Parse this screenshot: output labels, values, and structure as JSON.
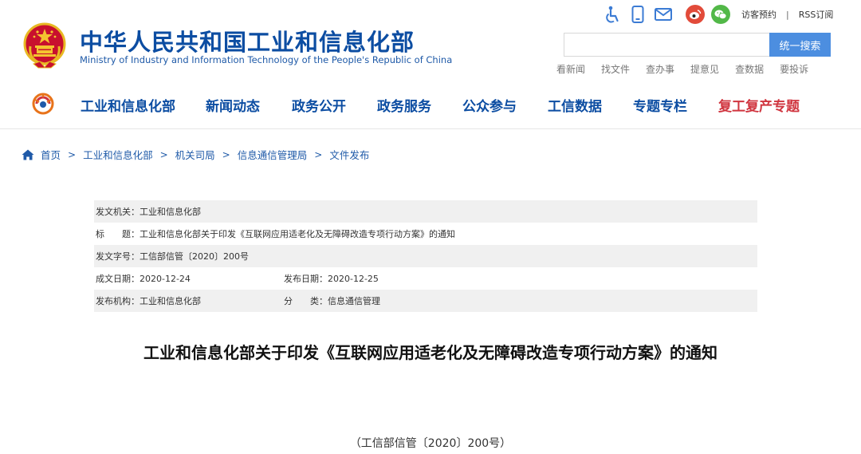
{
  "header": {
    "title": "中华人民共和国工业和信息化部",
    "subtitle": "Ministry of Industry and Information Technology of the People's Republic of China",
    "top_links": {
      "visit": "访客预约",
      "separator": "|",
      "rss": "RSS订阅"
    },
    "icons": [
      "accessibility-icon",
      "mobile-icon",
      "mail-icon",
      "weibo-icon",
      "wechat-icon"
    ],
    "search": {
      "placeholder": "",
      "button": "统一搜索"
    },
    "quick_links": [
      "看新闻",
      "找文件",
      "查办事",
      "提意见",
      "查数据",
      "要投诉"
    ]
  },
  "nav": {
    "items": [
      "工业和信息化部",
      "新闻动态",
      "政务公开",
      "政务服务",
      "公众参与",
      "工信数据",
      "专题专栏",
      "复工复产专题"
    ]
  },
  "breadcrumb": [
    "首页",
    "工业和信息化部",
    "机关司局",
    "信息通信管理局",
    "文件发布"
  ],
  "meta": {
    "issuer_label": "发文机关：",
    "issuer": "工业和信息化部",
    "title_label": "标　　题：",
    "title": "工业和信息化部关于印发《互联网应用适老化及无障碍改造专项行动方案》的通知",
    "doc_no_label": "发文字号：",
    "doc_no": "工信部信管〔2020〕200号",
    "created_label": "成文日期：",
    "created": "2020-12-24",
    "published_label": "发布日期：",
    "published": "2020-12-25",
    "org_label": "发布机构：",
    "org": "工业和信息化部",
    "category_label": "分　　类：",
    "category": "信息通信管理"
  },
  "document": {
    "title": "工业和信息化部关于印发《互联网应用适老化及无障碍改造专项行动方案》的通知",
    "number": "（工信部信管〔2020〕200号）"
  },
  "colors": {
    "brand_blue": "#0c4da2",
    "link_blue": "#1f5aa8",
    "search_button": "#4c8ee0",
    "special_red": "#d0353f",
    "row_shade": "#f0f0f0"
  }
}
